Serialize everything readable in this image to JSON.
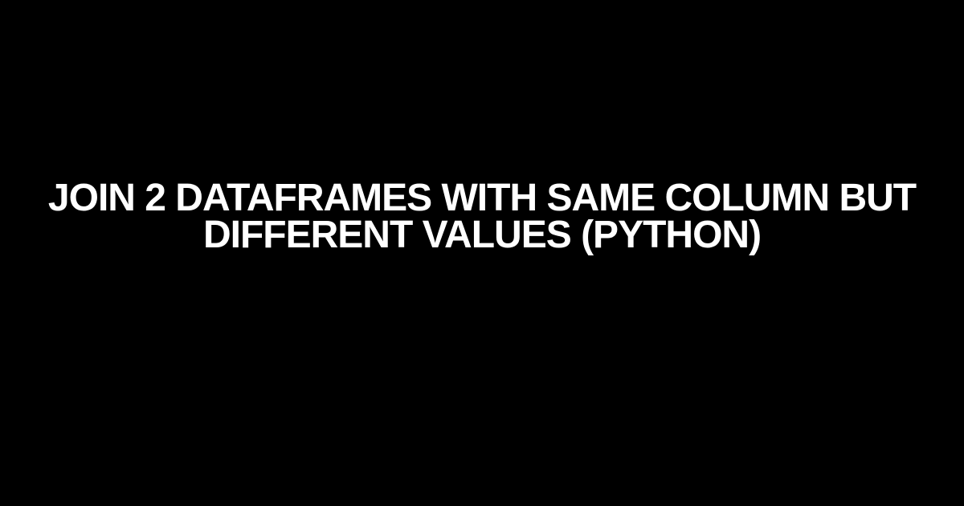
{
  "title": {
    "line1": "Join 2 dataframes with same column but",
    "line2": "different values (Python)"
  }
}
